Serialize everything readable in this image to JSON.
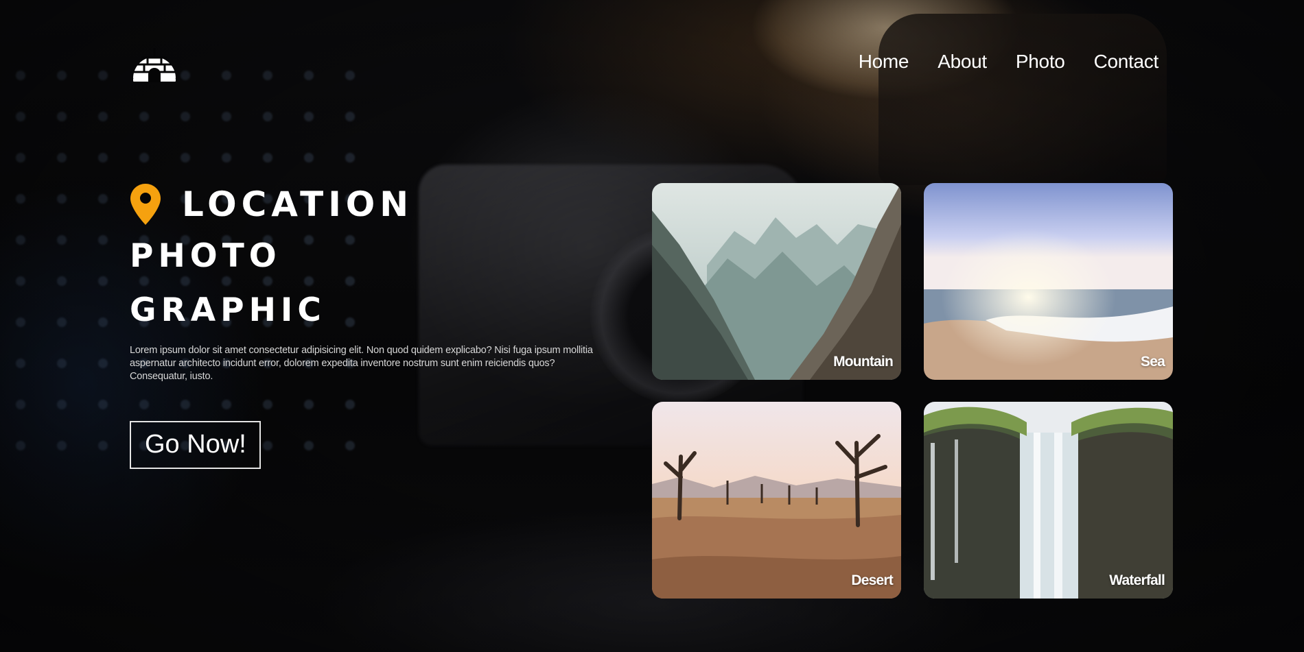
{
  "nav": {
    "items": [
      {
        "label": "Home"
      },
      {
        "label": "About"
      },
      {
        "label": "Photo"
      },
      {
        "label": "Contact"
      }
    ]
  },
  "hero": {
    "title_line1": "LOCATION",
    "title_line2": "PHOTO",
    "title_line3": "GRAPHIC",
    "description": "Lorem ipsum dolor sit amet consectetur adipisicing elit. Non quod quidem explicabo? Nisi fuga ipsum mollitia aspernatur architecto incidunt error, dolorem expedita inventore nostrum sunt enim reiciendis quos? Consequatur, iusto.",
    "cta_label": "Go Now!"
  },
  "gallery": {
    "cards": [
      {
        "label": "Mountain"
      },
      {
        "label": "Sea"
      },
      {
        "label": "Desert"
      },
      {
        "label": "Waterfall"
      }
    ]
  },
  "colors": {
    "accent": "#f5a10f",
    "text": "#ffffff",
    "background": "#050506"
  },
  "icons": {
    "logo": "igloo-logo-icon",
    "location": "map-pin-icon"
  }
}
